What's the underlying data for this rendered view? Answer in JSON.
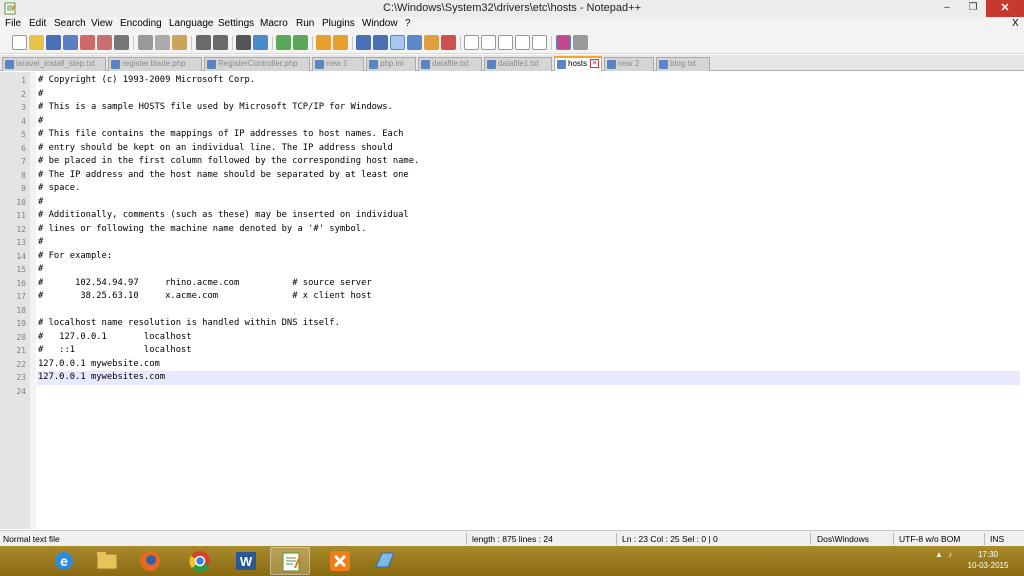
{
  "window": {
    "title": "C:\\Windows\\System32\\drivers\\etc\\hosts - Notepad++",
    "minimize": "–",
    "maximize": "❐",
    "close": "✕"
  },
  "menu": {
    "items": [
      "File",
      "Edit",
      "Search",
      "View",
      "Encoding",
      "Language",
      "Settings",
      "Macro",
      "Run",
      "Plugins",
      "Window",
      "?"
    ],
    "close_doc": "X"
  },
  "tabs": [
    {
      "label": "laravel_install_step.txt",
      "active": false
    },
    {
      "label": "register.blade.php",
      "active": false
    },
    {
      "label": "RegisterController.php",
      "active": false
    },
    {
      "label": "new 1",
      "active": false
    },
    {
      "label": "php.ini",
      "active": false
    },
    {
      "label": "datafile.txt",
      "active": false
    },
    {
      "label": "datafile1.txt",
      "active": false
    },
    {
      "label": "hosts",
      "active": true
    },
    {
      "label": "new 2",
      "active": false
    },
    {
      "label": "blog.txt",
      "active": false
    }
  ],
  "editor": {
    "current_line": 23,
    "lines": [
      "# Copyright (c) 1993-2009 Microsoft Corp.",
      "#",
      "# This is a sample HOSTS file used by Microsoft TCP/IP for Windows.",
      "#",
      "# This file contains the mappings of IP addresses to host names. Each",
      "# entry should be kept on an individual line. The IP address should",
      "# be placed in the first column followed by the corresponding host name.",
      "# The IP address and the host name should be separated by at least one",
      "# space.",
      "#",
      "# Additionally, comments (such as these) may be inserted on individual",
      "# lines or following the machine name denoted by a '#' symbol.",
      "#",
      "# For example:",
      "#",
      "#      102.54.94.97     rhino.acme.com          # source server",
      "#       38.25.63.10     x.acme.com              # x client host",
      "",
      "# localhost name resolution is handled within DNS itself.",
      "#   127.0.0.1       localhost",
      "#   ::1             localhost",
      "127.0.0.1 mywebsite.com",
      "127.0.0.1 mywebsites.com",
      ""
    ]
  },
  "status": {
    "file_type": "Normal text file",
    "length": "length : 875   lines : 24",
    "position": "Ln : 23   Col : 25   Sel : 0 | 0",
    "eol": "Dos\\Windows",
    "encoding": "UTF-8 w/o BOM",
    "mode": "INS"
  },
  "taskbar": {
    "apps": [
      "internet-explorer",
      "file-explorer",
      "firefox",
      "chrome",
      "word",
      "notepad-plus-plus",
      "xampp",
      "notepad"
    ],
    "clock_time": "17:30",
    "clock_date": "10-03-2015"
  },
  "colors": {
    "tab_active_accent": "#f5a623",
    "current_line_bg": "#e8e8ff",
    "close_button": "#c7392f"
  }
}
